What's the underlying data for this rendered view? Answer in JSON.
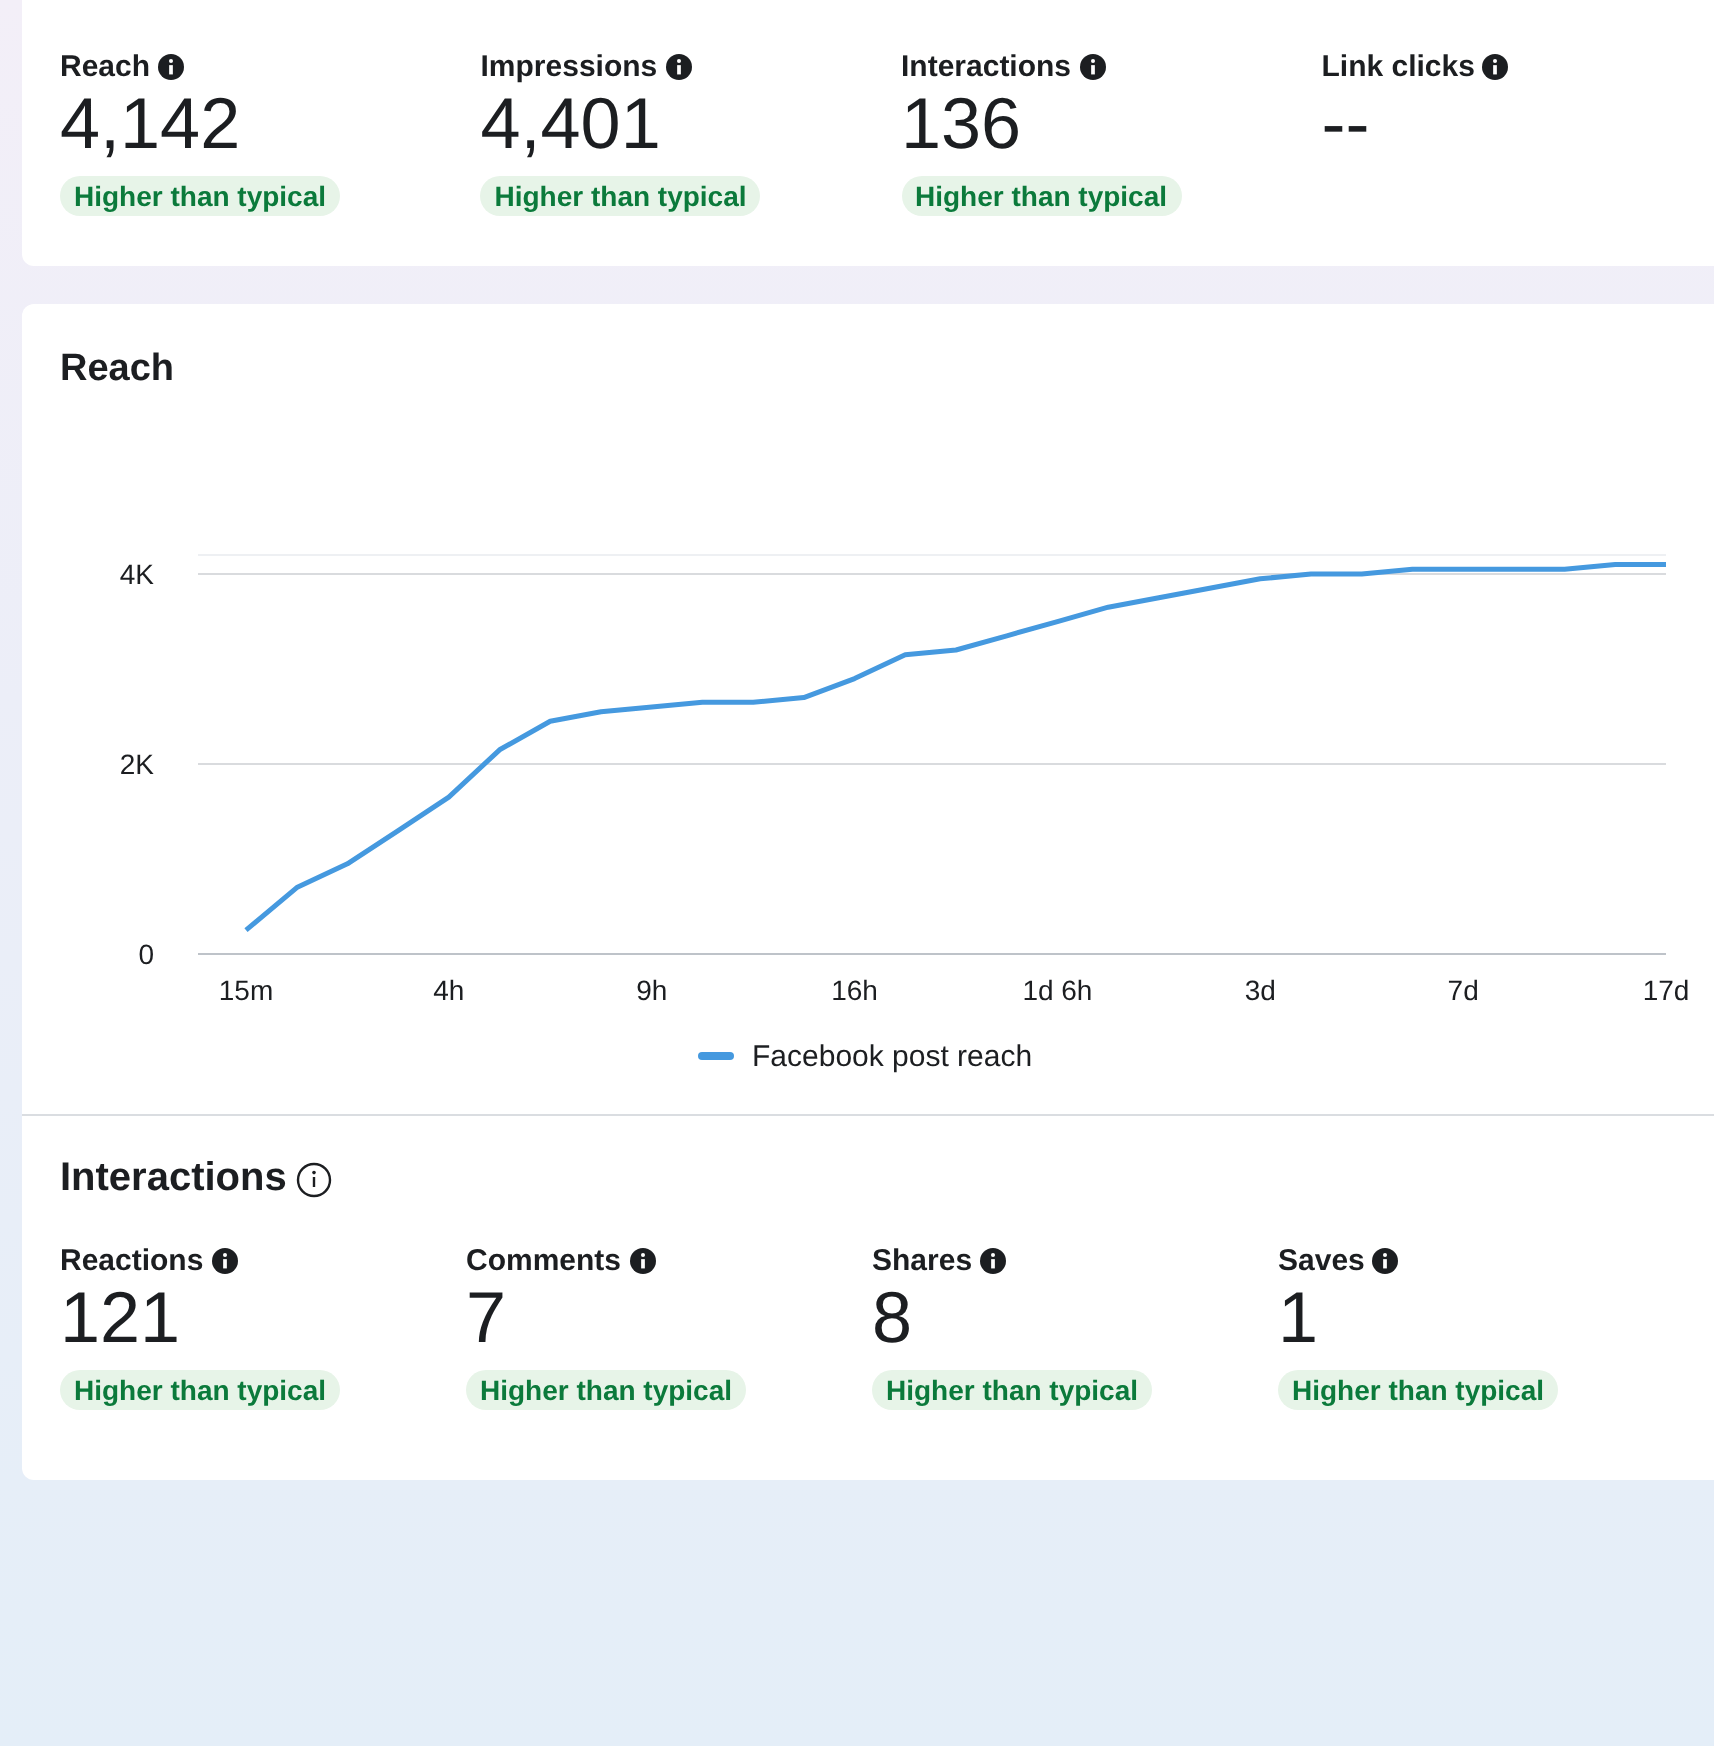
{
  "summary": [
    {
      "label": "Reach",
      "value": "4,142",
      "badge": "Higher than typical"
    },
    {
      "label": "Impressions",
      "value": "4,401",
      "badge": "Higher than typical"
    },
    {
      "label": "Interactions",
      "value": "136",
      "badge": "Higher than typical"
    },
    {
      "label": "Link clicks",
      "value": "--"
    }
  ],
  "reach": {
    "title": "Reach",
    "chart_data": {
      "type": "line",
      "categories": [
        "15m",
        null,
        null,
        null,
        "4h",
        null,
        null,
        null,
        "9h",
        null,
        null,
        null,
        "16h",
        null,
        null,
        null,
        "1d 6h",
        null,
        null,
        null,
        "3d",
        null,
        null,
        null,
        "7d",
        null,
        null,
        null,
        "17d"
      ],
      "series": [
        {
          "name": "Facebook post reach",
          "color": "#4599df",
          "values": [
            250,
            700,
            950,
            1300,
            1650,
            2150,
            2450,
            2550,
            2600,
            2650,
            2650,
            2700,
            2900,
            3150,
            3200,
            3350,
            3500,
            3650,
            3750,
            3850,
            3950,
            4000,
            4000,
            4050,
            4050,
            4050,
            4050,
            4100,
            4100
          ]
        }
      ],
      "ylim": [
        0,
        4200
      ],
      "yticks": [
        {
          "value": 0,
          "label": "0"
        },
        {
          "value": 2000,
          "label": "2K"
        },
        {
          "value": 4000,
          "label": "4K"
        }
      ]
    }
  },
  "interactions": {
    "title": "Interactions",
    "metrics": [
      {
        "label": "Reactions",
        "value": "121",
        "badge": "Higher than typical"
      },
      {
        "label": "Comments",
        "value": "7",
        "badge": "Higher than typical"
      },
      {
        "label": "Shares",
        "value": "8",
        "badge": "Higher than typical"
      },
      {
        "label": "Saves",
        "value": "1",
        "badge": "Higher than typical"
      }
    ]
  }
}
